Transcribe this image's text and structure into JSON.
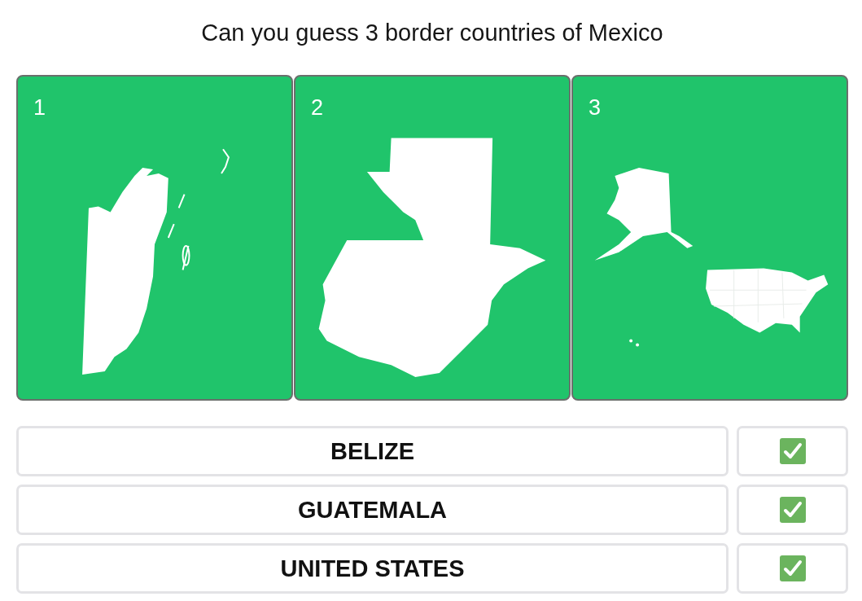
{
  "title": "Can you guess 3 border countries of Mexico",
  "maps": [
    {
      "number": "1"
    },
    {
      "number": "2"
    },
    {
      "number": "3"
    }
  ],
  "answers": [
    {
      "name": "BELIZE",
      "correct": true
    },
    {
      "name": "GUATEMALA",
      "correct": true
    },
    {
      "name": "UNITED STATES",
      "correct": true
    }
  ]
}
